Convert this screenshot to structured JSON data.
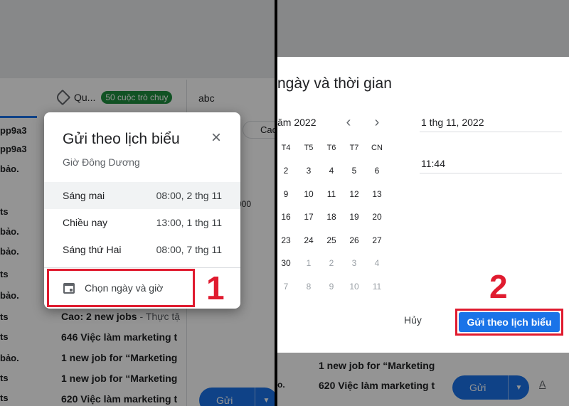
{
  "left": {
    "label_text": "Qu...",
    "chip_text": "50 cuộc trò chuy",
    "bg_rows": [
      "pp9a3",
      "pp9a3",
      "bảo.",
      "ts",
      "bảo.",
      "bảo.",
      "ts",
      "bảo.",
      "ts",
      "ts",
      "bảo.",
      "ts",
      "ts",
      "ts"
    ],
    "compose_subject": "abc",
    "compose_chip": "Caoth",
    "compose_ooo": "000",
    "mail_rows": [
      {
        "sender": "Cao: 2 new jobs",
        "snippet": " - Thực tậ"
      },
      {
        "sender": "646 Việc làm marketing t",
        "snippet": ""
      },
      {
        "sender": "1 new job for “Marketing",
        "snippet": ""
      },
      {
        "sender": "1 new job for “Marketing",
        "snippet": ""
      },
      {
        "sender": "620 Việc làm marketing t",
        "snippet": ""
      }
    ],
    "send_label": "Gửi",
    "dialog": {
      "title": "Gửi theo lịch biểu",
      "close_icon": "×",
      "timezone": "Giờ Đông Dương",
      "options": [
        {
          "label": "Sáng mai",
          "time": "08:00, 2 thg 11"
        },
        {
          "label": "Chiều nay",
          "time": "13:00, 1 thg 11"
        },
        {
          "label": "Sáng thứ Hai",
          "time": "08:00, 7 thg 11"
        }
      ],
      "pick_label": "Chọn ngày và giờ"
    },
    "step_number": "1"
  },
  "right": {
    "title": "ngày và thời gian",
    "month_label": "ăm 2022",
    "weekdays": [
      "T4",
      "T5",
      "T6",
      "T7",
      "CN"
    ],
    "weeks": [
      [
        "2",
        "3",
        "4",
        "5",
        "6"
      ],
      [
        "9",
        "10",
        "11",
        "12",
        "13"
      ],
      [
        "16",
        "17",
        "18",
        "19",
        "20"
      ],
      [
        "23",
        "24",
        "25",
        "26",
        "27"
      ],
      [
        "30",
        "1",
        "2",
        "3",
        "4"
      ],
      [
        "7",
        "8",
        "9",
        "10",
        "11"
      ]
    ],
    "date_value": "1 thg 11, 2022",
    "time_value": "11:44",
    "cancel_label": "Hủy",
    "schedule_label": "Gửi theo lịch biểu",
    "bg_rows": [
      {
        "sender": "1 new job for “Marketing"
      },
      {
        "sender": "620 Việc làm marketing t"
      }
    ],
    "bg_dot": "o.",
    "send_label": "Gửi",
    "format_label": "A",
    "step_number": "2",
    "icons": {
      "prev": "chevron-left-icon",
      "next": "chevron-right-icon"
    },
    "accent_color": "#1a73e8",
    "highlight_color": "#e01b2f"
  }
}
